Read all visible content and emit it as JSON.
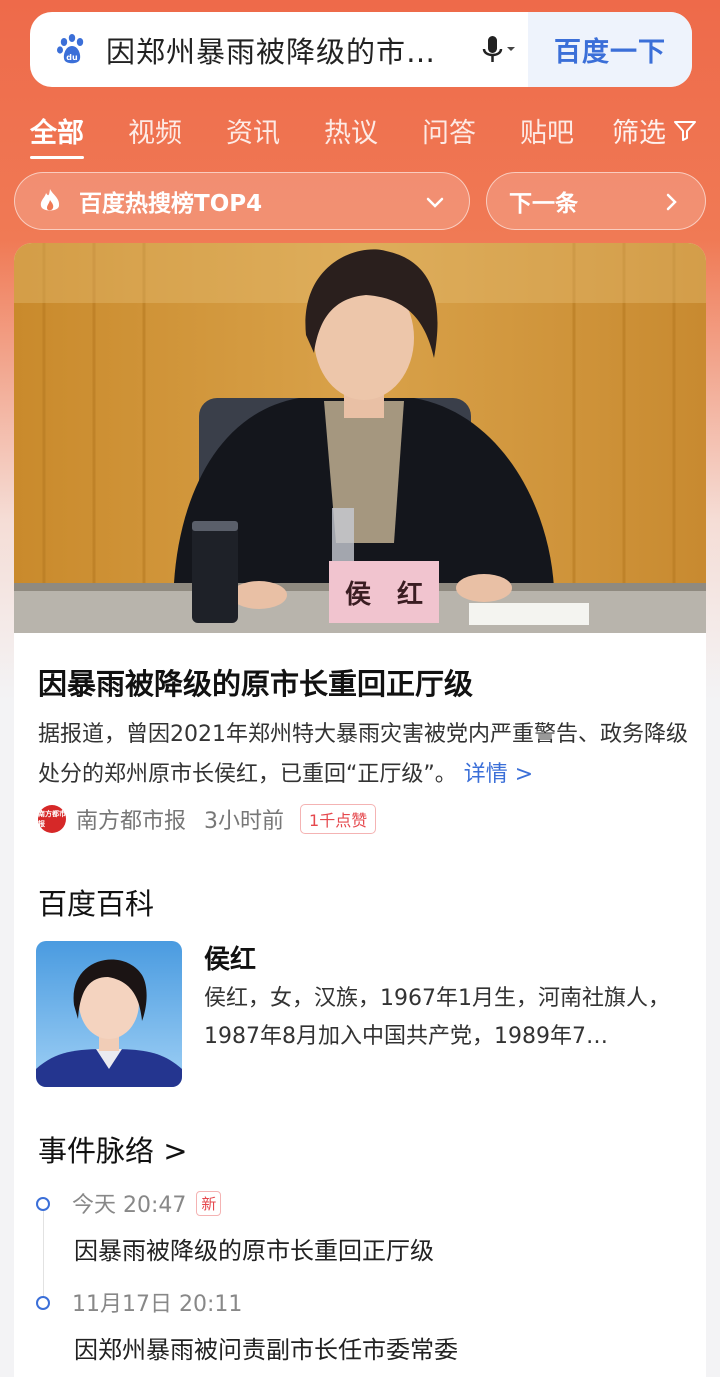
{
  "search": {
    "query": "因郑州暴雨被降级的市…",
    "button_label": "百度一下"
  },
  "tabs": [
    {
      "label": "全部",
      "active": true
    },
    {
      "label": "视频"
    },
    {
      "label": "资讯"
    },
    {
      "label": "热议"
    },
    {
      "label": "问答"
    },
    {
      "label": "贴吧"
    }
  ],
  "filter_label": "筛选",
  "hot": {
    "label": "百度热搜榜TOP4",
    "next_label": "下一条"
  },
  "hero": {
    "nameplate": "侯　红"
  },
  "news": {
    "headline": "因暴雨被降级的原市长重回正厅级",
    "summary": "据报道，曾因2021年郑州特大暴雨灾害被党内严重警告、政务降级处分的郑州原市长侯红，已重回“正厅级”。",
    "more_label": "详情 >",
    "source": "南方都市报",
    "source_logo_text": "南方都市报",
    "time": "3小时前",
    "likes": "1千点赞"
  },
  "baike": {
    "section_title": "百度百科",
    "name": "侯红",
    "desc": "侯红，女，汉族，1967年1月生，河南社旗人，1987年8月加入中国共产党，1989年7…"
  },
  "events": {
    "section_title": "事件脉络 >",
    "items": [
      {
        "time": "今天 20:47",
        "badge": "新",
        "title": "因暴雨被降级的原市长重回正厅级"
      },
      {
        "time": "11月17日 20:11",
        "title": "因郑州暴雨被问责副市长任市委常委"
      }
    ]
  },
  "colors": {
    "accent_blue": "#3b6fd8",
    "hot_red": "#ee6a4a"
  }
}
